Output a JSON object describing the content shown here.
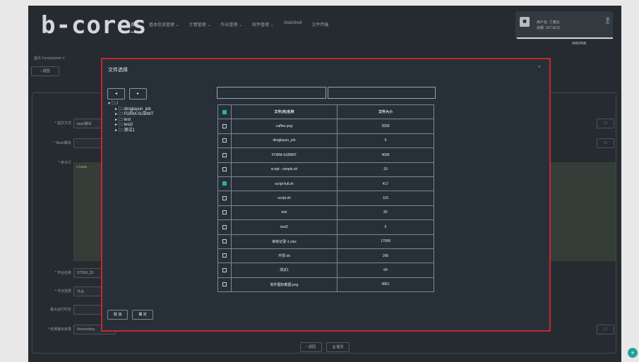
{
  "app": {
    "logo": "b-cores",
    "nav": [
      "首页",
      "基本信息管理 ⌄",
      "计算管理 ⌄",
      "作业管理 ⌄",
      "软件管理 ⌄",
      "WebShell",
      "文件传输"
    ],
    "user": {
      "line1": "用户名: 丁鑫云",
      "line2": "余额: 107.82元",
      "logout": "退出"
    },
    "usage_text": "0KB/0KB",
    "breadcrumb": "首页  FormSubmit ✕",
    "back_label": "‹ 返回"
  },
  "form": {
    "rows": [
      {
        "label": "* 提交方式",
        "value": "bash脚本"
      },
      {
        "label": "* Bash脚本",
        "value": ""
      },
      {
        "label": "* 命令行",
        "value": "sleep"
      },
      {
        "label": "* 作业名称",
        "value": "STDIN_20"
      },
      {
        "label": "* 节点选择",
        "value": "节点"
      },
      {
        "label": "最大运行时长",
        "value": ""
      },
      {
        "label": "* 标准输出目录",
        "value": "/home/ding"
      }
    ],
    "folder_icon": "□",
    "back_label": "‹ 返回",
    "submit_label": "⎙ 提交"
  },
  "modal": {
    "title": "文件选择",
    "close": "×",
    "tree_back": "◂",
    "tree_forward": "▸",
    "tree": [
      {
        "label": "▾ 🗀 /",
        "level": 0
      },
      {
        "label": "▸ 🗀 dingjiayun_job",
        "level": 1
      },
      {
        "label": "▸ 🗀 FORM-SUBMIT",
        "level": 1
      },
      {
        "label": "▸ 🗀 test",
        "level": 1
      },
      {
        "label": "▸ 🗀 test2",
        "level": 1
      },
      {
        "label": "▸ 🗀 测试1",
        "level": 1
      }
    ],
    "table": {
      "headers": [
        "文件[夹]名称",
        "文件大小"
      ],
      "rows": [
        {
          "checked": false,
          "name": "caffee.png",
          "size": "3939"
        },
        {
          "checked": false,
          "name": "dingjiayun_job",
          "size": "6"
        },
        {
          "checked": false,
          "name": "FORM-SUBMIT",
          "size": "4096"
        },
        {
          "checked": false,
          "name": "script - simple.sh",
          "size": "33"
        },
        {
          "checked": true,
          "name": "script-full.sh",
          "size": "417"
        },
        {
          "checked": false,
          "name": "script.sh",
          "size": "116"
        },
        {
          "checked": false,
          "name": "test",
          "size": "80"
        },
        {
          "checked": false,
          "name": "test2",
          "size": "6"
        },
        {
          "checked": false,
          "name": "审核记录-1.xlsx",
          "size": "17099"
        },
        {
          "checked": false,
          "name": "开票.txt",
          "size": "266"
        },
        {
          "checked": false,
          "name": "测试1",
          "size": "64"
        },
        {
          "checked": false,
          "name": "软件图标截图.png",
          "size": "4851"
        }
      ]
    },
    "cancel_label": "取 消",
    "confirm_label": "确 定"
  },
  "fab": "+"
}
